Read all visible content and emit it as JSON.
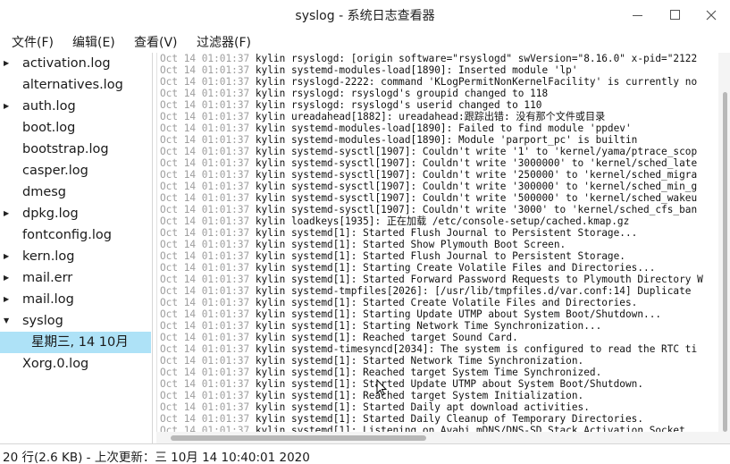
{
  "window": {
    "title": "syslog - 系统日志查看器"
  },
  "menu": [
    "文件(F)",
    "编辑(E)",
    "查看(V)",
    "过滤器(F)"
  ],
  "sidebar": {
    "items": [
      {
        "label": "activation.log",
        "expandable": true
      },
      {
        "label": "alternatives.log",
        "expandable": false
      },
      {
        "label": "auth.log",
        "expandable": true
      },
      {
        "label": "boot.log",
        "expandable": false
      },
      {
        "label": "bootstrap.log",
        "expandable": false
      },
      {
        "label": "casper.log",
        "expandable": false
      },
      {
        "label": "dmesg",
        "expandable": false
      },
      {
        "label": "dpkg.log",
        "expandable": true
      },
      {
        "label": "fontconfig.log",
        "expandable": false
      },
      {
        "label": "kern.log",
        "expandable": true
      },
      {
        "label": "mail.err",
        "expandable": true
      },
      {
        "label": "mail.log",
        "expandable": true
      },
      {
        "label": "syslog",
        "expanded": true
      },
      {
        "label": "星期三, 14 10月",
        "child": true,
        "selected": true
      },
      {
        "label": "Xorg.0.log",
        "expandable": false
      }
    ]
  },
  "log": {
    "date": "Oct 14 01:01:37",
    "lines": [
      "kylin rsyslogd: [origin software=\"rsyslogd\" swVersion=\"8.16.0\" x-pid=\"2122",
      "kylin systemd-modules-load[1890]: Inserted module 'lp'",
      "kylin rsyslogd-2222: command 'KLogPermitNonKernelFacility' is currently no",
      "kylin rsyslogd: rsyslogd's groupid changed to 118",
      "kylin rsyslogd: rsyslogd's userid changed to 110",
      "kylin ureadahead[1882]: ureadahead:跟踪出错: 没有那个文件或目录",
      "kylin systemd-modules-load[1890]: Failed to find module 'ppdev'",
      "kylin systemd-modules-load[1890]: Module 'parport_pc' is builtin",
      "kylin systemd-sysctl[1907]: Couldn't write '1' to 'kernel/yama/ptrace_scop",
      "kylin systemd-sysctl[1907]: Couldn't write '3000000' to 'kernel/sched_late",
      "kylin systemd-sysctl[1907]: Couldn't write '250000' to 'kernel/sched_migra",
      "kylin systemd-sysctl[1907]: Couldn't write '300000' to 'kernel/sched_min_g",
      "kylin systemd-sysctl[1907]: Couldn't write '500000' to 'kernel/sched_wakeu",
      "kylin systemd-sysctl[1907]: Couldn't write '3000' to 'kernel/sched_cfs_ban",
      "kylin loadkeys[1935]: 正在加载 /etc/console-setup/cached.kmap.gz",
      "kylin systemd[1]: Started Flush Journal to Persistent Storage...",
      "kylin systemd[1]: Started Show Plymouth Boot Screen.",
      "kylin systemd[1]: Started Flush Journal to Persistent Storage.",
      "kylin systemd[1]: Starting Create Volatile Files and Directories...",
      "kylin systemd[1]: Started Forward Password Requests to Plymouth Directory W",
      "kylin systemd-tmpfiles[2026]: [/usr/lib/tmpfiles.d/var.conf:14] Duplicate",
      "kylin systemd[1]: Started Create Volatile Files and Directories.",
      "kylin systemd[1]: Starting Update UTMP about System Boot/Shutdown...",
      "kylin systemd[1]: Starting Network Time Synchronization...",
      "kylin systemd[1]: Reached target Sound Card.",
      "kylin systemd-timesyncd[2034]: The system is configured to read the RTC ti",
      "kylin systemd[1]: Started Network Time Synchronization.",
      "kylin systemd[1]: Reached target System Time Synchronized.",
      "kylin systemd[1]: Started Update UTMP about System Boot/Shutdown.",
      "kylin systemd[1]: Reached target System Initialization.",
      "kylin systemd[1]: Started Daily apt download activities.",
      "kylin systemd[1]: Started Daily Cleanup of Temporary Directories.",
      "kylin systemd[1]: Listening on Avahi mDNS/DNS-SD Stack Activation Socket."
    ]
  },
  "status": {
    "text": "20 行(2.6 KB) - 上次更新：三 10月 14 10:40:01 2020"
  }
}
